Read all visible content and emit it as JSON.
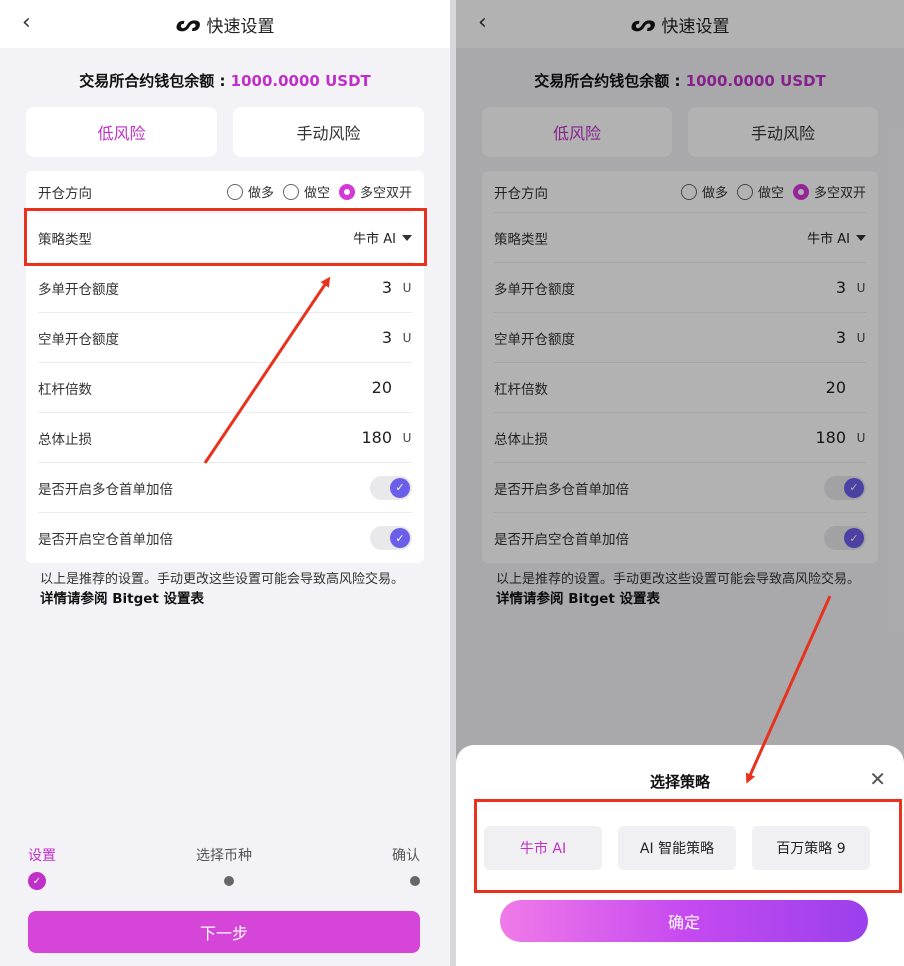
{
  "header": {
    "title": "快速设置",
    "back_icon": "chevron-left-icon"
  },
  "balance": {
    "label": "交易所合约钱包余额 : ",
    "amount": "1000.0000 USDT"
  },
  "risk_tabs": [
    {
      "label": "低风险",
      "active": true
    },
    {
      "label": "手动风险",
      "active": false
    }
  ],
  "direction": {
    "label": "开仓方向",
    "options": [
      {
        "label": "做多",
        "selected": false
      },
      {
        "label": "做空",
        "selected": false
      },
      {
        "label": "多空双开",
        "selected": true
      }
    ]
  },
  "strategy": {
    "label": "策略类型",
    "value": "牛市 AI"
  },
  "long_amount": {
    "label": "多单开仓额度",
    "value": "3",
    "unit": "U"
  },
  "short_amount": {
    "label": "空单开仓额度",
    "value": "3",
    "unit": "U"
  },
  "leverage": {
    "label": "杠杆倍数",
    "value": "20"
  },
  "stop_loss": {
    "label": "总体止损",
    "value": "180",
    "unit": "U"
  },
  "long_double": {
    "label": "是否开启多仓首单加倍",
    "on": true
  },
  "short_double": {
    "label": "是否开启空仓首单加倍",
    "on": true
  },
  "note": {
    "text": "以上是推荐的设置。手动更改这些设置可能会导致高风险交易。",
    "link": "详情请参阅 Bitget 设置表"
  },
  "steps": [
    {
      "label": "设置",
      "active": true
    },
    {
      "label": "选择币种",
      "active": false
    },
    {
      "label": "确认",
      "active": false
    }
  ],
  "next_button": "下一步",
  "sheet": {
    "title": "选择策略",
    "options": [
      {
        "label": "牛市 AI",
        "selected": true
      },
      {
        "label": "AI 智能策略",
        "selected": false
      },
      {
        "label": "百万策略 9",
        "selected": false
      }
    ],
    "confirm": "确定"
  },
  "colors": {
    "accent": "#c030c8",
    "highlight": "#e8321e",
    "toggle": "#6b5ee8"
  }
}
